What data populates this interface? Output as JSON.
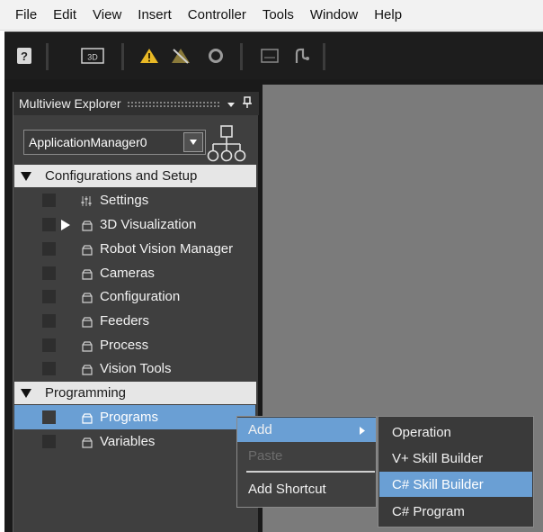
{
  "menubar": {
    "items": [
      "File",
      "Edit",
      "View",
      "Insert",
      "Controller",
      "Tools",
      "Window",
      "Help"
    ]
  },
  "toolbar": {
    "buttons": [
      "help-icon",
      "3d-view-icon",
      "warning-icon",
      "warning-off-icon",
      "refresh-icon",
      "monitor-icon",
      "robot-arm-icon"
    ],
    "label_3d": "3D"
  },
  "explorer": {
    "title": "Multiview Explorer",
    "pin": "▾ ⊥",
    "app_selector": {
      "value": "ApplicationManager0"
    },
    "sections": [
      {
        "label": "Configurations and Setup",
        "items": [
          {
            "label": "Settings",
            "icon": "settings-icon"
          },
          {
            "label": "3D Visualization",
            "icon": "folder-icon",
            "expandable": true
          },
          {
            "label": "Robot Vision Manager",
            "icon": "folder-icon"
          },
          {
            "label": "Cameras",
            "icon": "folder-icon"
          },
          {
            "label": "Configuration",
            "icon": "folder-icon"
          },
          {
            "label": "Feeders",
            "icon": "folder-icon"
          },
          {
            "label": "Process",
            "icon": "folder-icon"
          },
          {
            "label": "Vision Tools",
            "icon": "folder-icon"
          }
        ]
      },
      {
        "label": "Programming",
        "items": [
          {
            "label": "Programs",
            "icon": "folder-icon",
            "selected": true
          },
          {
            "label": "Variables",
            "icon": "folder-icon"
          }
        ]
      }
    ]
  },
  "context_menu": {
    "items": [
      {
        "label": "Add",
        "has_submenu": true,
        "highlighted": true
      },
      {
        "label": "Paste",
        "disabled": true
      },
      {
        "label": "Add Shortcut"
      }
    ]
  },
  "submenu": {
    "items": [
      {
        "label": "Operation"
      },
      {
        "label": "V+ Skill Builder"
      },
      {
        "label": "C# Skill Builder",
        "highlighted": true
      },
      {
        "label": "C# Program"
      }
    ]
  },
  "colors": {
    "selection": "#6a9fd4",
    "panel": "#3f3f3f",
    "warning": "#e8b825"
  }
}
